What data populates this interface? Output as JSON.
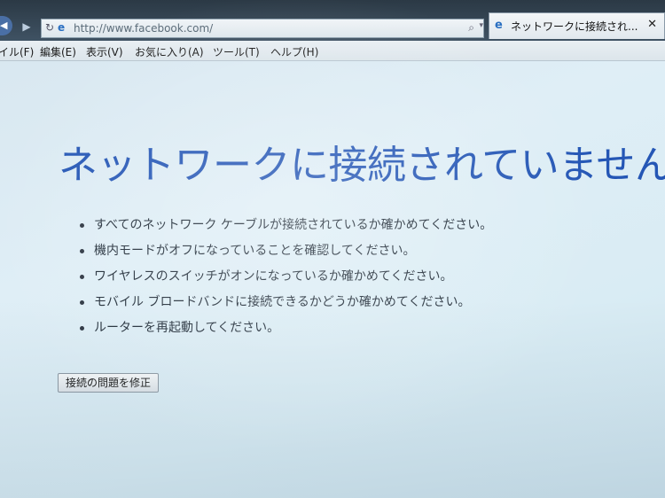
{
  "browser": {
    "address_url": "http://www.facebook.com/",
    "tab_title": "ネットワークに接続され..."
  },
  "menu": {
    "items": [
      {
        "label": "イル(F)"
      },
      {
        "label": "編集(E)"
      },
      {
        "label": "表示(V)"
      },
      {
        "label": "お気に入り(A)"
      },
      {
        "label": "ツール(T)"
      },
      {
        "label": "ヘルプ(H)"
      }
    ]
  },
  "page": {
    "title": "ネットワークに接続されていません",
    "checklist": [
      "すべてのネットワーク ケーブルが接続されているか確かめてください。",
      "機内モードがオフになっていることを確認してください。",
      "ワイヤレスのスイッチがオンになっているか確かめてください。",
      "モバイル ブロードバンドに接続できるかどうか確かめてください。",
      "ルーターを再起動してください。"
    ],
    "fix_button_label": "接続の問題を修正"
  },
  "colors": {
    "title_blue": "#2456b5",
    "background": "#dfeef6"
  },
  "icons": {
    "back": "back-arrow-icon",
    "forward": "forward-arrow-icon",
    "refresh": "refresh-icon",
    "site": "ie-icon",
    "search": "search-icon",
    "close": "close-icon"
  }
}
